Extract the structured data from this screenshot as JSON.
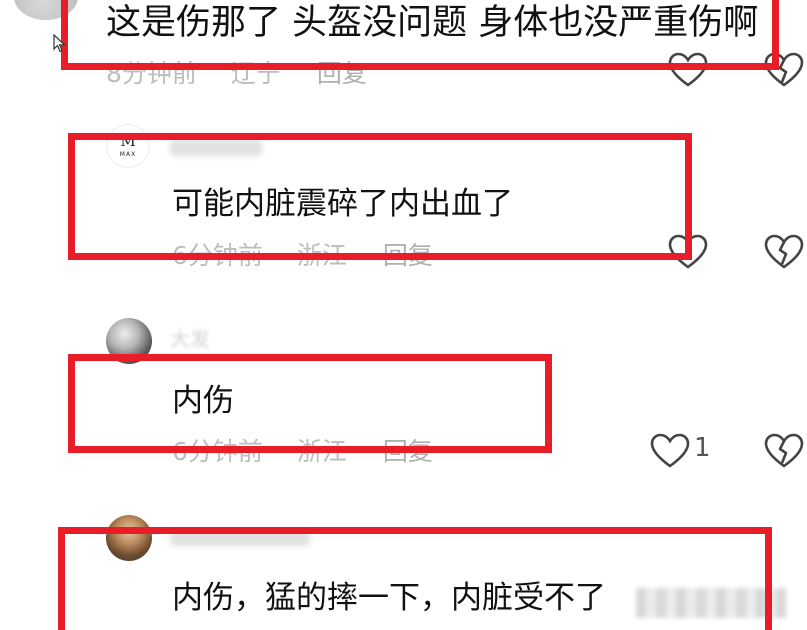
{
  "comments": [
    {
      "text": "这是伤那了 头盔没问题 身体也没严重伤啊",
      "time": "8分钟前",
      "location": "辽宁",
      "reply_label": "回复"
    },
    {
      "avatar_text": "MAX",
      "avatar_letter": "M",
      "text": "可能内脏震碎了内出血了",
      "time": "6分钟前",
      "location": "浙江",
      "reply_label": "回复"
    },
    {
      "username": "大发",
      "text": "内伤",
      "time": "6分钟前",
      "location": "浙江",
      "reply_label": "回复",
      "like_count": "1"
    },
    {
      "text": "内伤，猛的摔一下，内脏受不了"
    }
  ],
  "colors": {
    "highlight": "#e81d27",
    "meta_text": "#bdbdbd",
    "comment_text": "#111111",
    "icon": "#444444"
  },
  "icons": {
    "like": "heart-outline-icon",
    "dislike": "broken-heart-icon"
  }
}
